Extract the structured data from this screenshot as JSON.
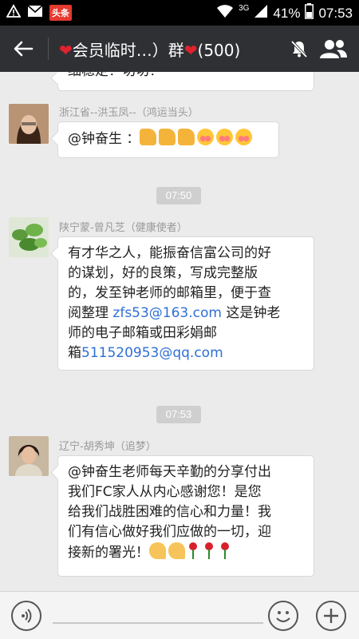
{
  "status_bar": {
    "notification_app_label": "头条",
    "network": "3G",
    "battery": "41%",
    "time": "07:53"
  },
  "title_bar": {
    "title_prefix": "会员临时…）群",
    "member_count": "(500)",
    "accent_heart_color": "#e0222e"
  },
  "messages": [
    {
      "type": "text",
      "partial": true,
      "text": "细稳定！切切！"
    },
    {
      "type": "text",
      "sender": "浙江省--洪玉凤--（鸿运当头）",
      "mention": "@钟奋生 ：",
      "emojis": [
        "thumbs-up",
        "thumbs-up",
        "thumbs-up",
        "blush",
        "blush",
        "blush"
      ]
    },
    {
      "type": "time",
      "time": "07:50"
    },
    {
      "type": "text",
      "sender": "陕宁蒙-曾凡芝（健康使者）",
      "lines": [
        "有才华之人，能振奋信富公司的好",
        "的谋划，好的良策，写成完整版",
        "的，发至钟老师的邮箱里，便于查"
      ],
      "line4_before": "阅整理 ",
      "email1": "zfs53@163.com",
      "line4_after": "  这是钟老",
      "line5": "师的电子邮箱或田彩娟邮",
      "line6_before": "箱",
      "email2": "511520953@qq.com"
    },
    {
      "type": "time",
      "time": "07:53"
    },
    {
      "type": "text",
      "sender": "辽宁-胡秀坤（追梦）",
      "lines": [
        "@钟奋生老师每天辛勤的分享付出",
        "我们FC家人从内心感谢您！是您",
        "给我们战胜困难的信心和力量！我",
        "们有信心做好我们应做的一切，迎"
      ],
      "last_line": "接新的署光！",
      "emojis": [
        "clap",
        "clap",
        "rose",
        "rose",
        "rose"
      ]
    }
  ],
  "input_bar": {
    "voice_icon": "voice-icon",
    "emoji_icon": "smiley-icon",
    "more_icon": "plus-icon"
  }
}
